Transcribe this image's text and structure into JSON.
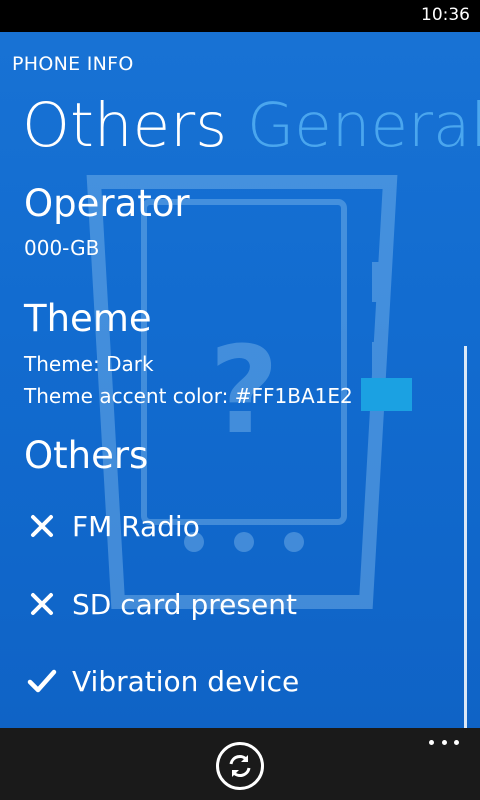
{
  "status_bar": {
    "time": "10:36"
  },
  "header": {
    "app_title": "PHONE INFO"
  },
  "pivot": {
    "active": "Others",
    "next": "General"
  },
  "operator": {
    "title": "Operator",
    "value": "000-GB"
  },
  "theme": {
    "title": "Theme",
    "theme_line": "Theme: Dark",
    "accent_line": "Theme accent color: #FF1BA1E2",
    "accent_color": "#1BA1E2"
  },
  "others": {
    "title": "Others",
    "items": [
      {
        "label": "FM Radio",
        "icon": "cross-icon",
        "state": "absent"
      },
      {
        "label": "SD card present",
        "icon": "cross-icon",
        "state": "absent"
      },
      {
        "label": "Vibration device",
        "icon": "check-icon",
        "state": "present"
      }
    ]
  },
  "app_bar": {
    "refresh_icon": "refresh-icon",
    "more_icon": "more-icon"
  }
}
